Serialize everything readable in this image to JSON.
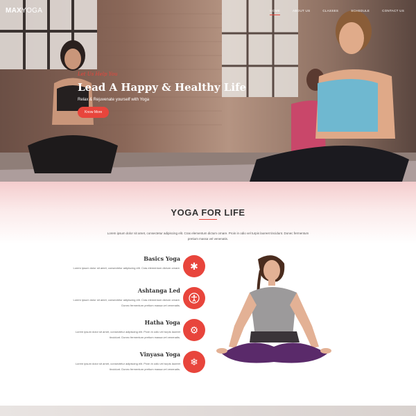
{
  "nav": {
    "logo_bold": "MAX",
    "logo_thin": "YOGA",
    "items": [
      {
        "label": "HOME",
        "active": true
      },
      {
        "label": "ABOUT US",
        "active": false
      },
      {
        "label": "CLASSES",
        "active": false
      },
      {
        "label": "SCHEDULE",
        "active": false
      },
      {
        "label": "CONTACT US",
        "active": false
      }
    ]
  },
  "hero": {
    "kicker": "Let Us Help You",
    "headline": "Lead A Happy & Healthy Life",
    "subline": "Relax & Rejuvenate yourself with Yoga",
    "cta": "Know More"
  },
  "intro": {
    "title": "YOGA FOR LIFE",
    "text": "Lorem ipsum dolor sit amet, consectetur adipiscing elit. Cras elementum dictum ornare. Proin in odio vel turpis laoreet tincidunt. Donec fermentum pretium massa vel venenatis."
  },
  "features": [
    {
      "name": "Basics Yoga",
      "desc": "Lorem ipsum dolor sit amet, consectetur adipiscing elit. Cras elementum dictum ornare.",
      "icon": "asterisk-icon"
    },
    {
      "name": "Ashtanga Led",
      "desc": "Lorem ipsum dolor sit amet, consectetur adipiscing elit. Cras elementum dictum ornare. Donec fermentum pretium massa vel venenatis.",
      "icon": "person-icon"
    },
    {
      "name": "Hatha Yoga",
      "desc": "Lorem ipsum dolor sit amet, consectetur adipiscing elit. Proin in odio vel turpis laoreet tincidunt. Donec fermentum pretium massa vel venenatis.",
      "icon": "gear-icon"
    },
    {
      "name": "Vinyasa Yoga",
      "desc": "Lorem ipsum dolor sit amet, consectetur adipiscing elit. Proin in odio vel turpis laoreet tincidunt. Donec fermentum pretium massa vel venenatis.",
      "icon": "snowflake-icon"
    }
  ],
  "colors": {
    "accent": "#e8453c",
    "text": "#333333"
  }
}
